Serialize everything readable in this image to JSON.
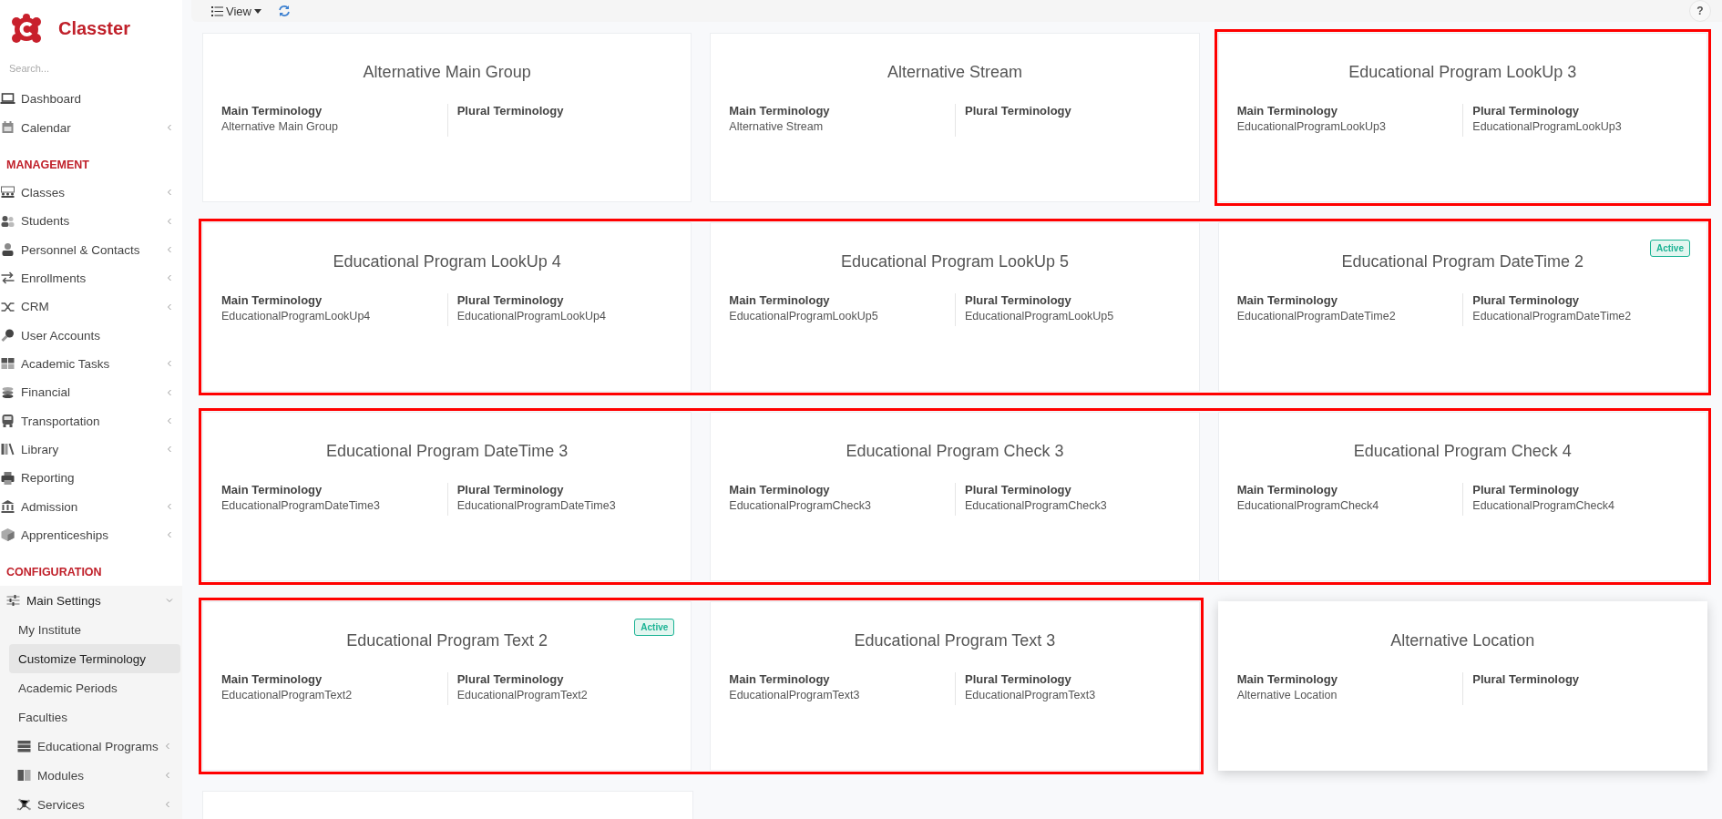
{
  "brand": {
    "name": "Classter"
  },
  "search": {
    "placeholder": "Search..."
  },
  "nav": [
    {
      "kind": "item",
      "label": "Dashboard",
      "expandable": false,
      "selected": false
    },
    {
      "kind": "item",
      "label": "Calendar",
      "expandable": true,
      "expanded": false,
      "selected": false
    },
    {
      "kind": "header",
      "label": "MANAGEMENT"
    },
    {
      "kind": "item",
      "label": "Classes",
      "expandable": true,
      "expanded": false,
      "selected": false
    },
    {
      "kind": "item",
      "label": "Students",
      "expandable": true,
      "expanded": false,
      "selected": false
    },
    {
      "kind": "item",
      "label": "Personnel & Contacts",
      "expandable": true,
      "expanded": false,
      "selected": false
    },
    {
      "kind": "item",
      "label": "Enrollments",
      "expandable": true,
      "expanded": false,
      "selected": false
    },
    {
      "kind": "item",
      "label": "CRM",
      "expandable": true,
      "expanded": false,
      "selected": false
    },
    {
      "kind": "item",
      "label": "User Accounts",
      "expandable": false,
      "selected": false
    },
    {
      "kind": "item",
      "label": "Academic Tasks",
      "expandable": true,
      "expanded": false,
      "selected": false
    },
    {
      "kind": "item",
      "label": "Financial",
      "expandable": true,
      "expanded": false,
      "selected": false
    },
    {
      "kind": "item",
      "label": "Transportation",
      "expandable": true,
      "expanded": false,
      "selected": false
    },
    {
      "kind": "item",
      "label": "Library",
      "expandable": true,
      "expanded": false,
      "selected": false
    },
    {
      "kind": "item",
      "label": "Reporting",
      "expandable": false,
      "selected": false
    },
    {
      "kind": "item",
      "label": "Admission",
      "expandable": true,
      "expanded": false,
      "selected": false
    },
    {
      "kind": "item",
      "label": "Apprenticeships",
      "expandable": true,
      "expanded": false,
      "selected": false
    },
    {
      "kind": "header",
      "label": "CONFIGURATION"
    },
    {
      "kind": "item",
      "label": "Main Settings",
      "expandable": true,
      "expanded": true,
      "selected": false,
      "children": [
        {
          "kind": "link",
          "label": "My Institute",
          "selected": false
        },
        {
          "kind": "link",
          "label": "Customize Terminology",
          "selected": true
        },
        {
          "kind": "link",
          "label": "Academic Periods",
          "selected": false
        },
        {
          "kind": "link",
          "label": "Faculties",
          "selected": false
        },
        {
          "kind": "item",
          "label": "Educational Programs",
          "expandable": true,
          "expanded": false,
          "selected": false
        },
        {
          "kind": "item",
          "label": "Modules",
          "expandable": true,
          "expanded": false,
          "selected": false
        },
        {
          "kind": "item",
          "label": "Services",
          "expandable": true,
          "expanded": false,
          "selected": false
        }
      ]
    }
  ],
  "toolbar": {
    "view_label": "View",
    "help": "?"
  },
  "rows": [
    {
      "cards": [
        {
          "title": "Alternative Main Group",
          "main_label": "Main Terminology",
          "main_value": "Alternative Main Group",
          "plural_label": "Plural Terminology",
          "highlighted": false,
          "hovered": false
        },
        {
          "title": "Alternative Stream",
          "main_label": "Main Terminology",
          "main_value": "Alternative Stream",
          "plural_label": "Plural Terminology",
          "highlighted": false,
          "hovered": false
        },
        {
          "title": "Educational Program LookUp 3",
          "main_label": "Main Terminology",
          "main_value": "EducationalProgramLookUp3",
          "plural_label": "Plural Terminology",
          "plural_value": "EducationalProgramLookUp3",
          "highlighted": true,
          "hovered": false
        }
      ]
    },
    {
      "cards": [
        {
          "title": "Educational Program LookUp 4",
          "main_label": "Main Terminology",
          "main_value": "EducationalProgramLookUp4",
          "plural_label": "Plural Terminology",
          "plural_value": "EducationalProgramLookUp4",
          "highlighted": true,
          "hovered": false
        },
        {
          "title": "Educational Program LookUp 5",
          "main_label": "Main Terminology",
          "main_value": "EducationalProgramLookUp5",
          "plural_label": "Plural Terminology",
          "plural_value": "EducationalProgramLookUp5",
          "highlighted": true,
          "hovered": false
        },
        {
          "title": "Educational Program DateTime 2",
          "badge": "Active",
          "main_label": "Main Terminology",
          "main_value": "EducationalProgramDateTime2",
          "plural_label": "Plural Terminology",
          "plural_value": "EducationalProgramDateTime2",
          "highlighted": true,
          "hovered": false
        }
      ]
    },
    {
      "cards": [
        {
          "title": "Educational Program DateTime 3",
          "main_label": "Main Terminology",
          "main_value": "EducationalProgramDateTime3",
          "plural_label": "Plural Terminology",
          "plural_value": "EducationalProgramDateTime3",
          "highlighted": true,
          "hovered": false
        },
        {
          "title": "Educational Program Check 3",
          "main_label": "Main Terminology",
          "main_value": "EducationalProgramCheck3",
          "plural_label": "Plural Terminology",
          "plural_value": "EducationalProgramCheck3",
          "highlighted": true,
          "hovered": false
        },
        {
          "title": "Educational Program Check 4",
          "main_label": "Main Terminology",
          "main_value": "EducationalProgramCheck4",
          "plural_label": "Plural Terminology",
          "plural_value": "EducationalProgramCheck4",
          "highlighted": true,
          "hovered": false
        }
      ]
    },
    {
      "cards": [
        {
          "title": "Educational Program Text 2",
          "badge": "Active",
          "main_label": "Main Terminology",
          "main_value": "EducationalProgramText2",
          "plural_label": "Plural Terminology",
          "plural_value": "EducationalProgramText2",
          "highlighted": true,
          "hovered": false
        },
        {
          "title": "Educational Program Text 3",
          "main_label": "Main Terminology",
          "main_value": "EducationalProgramText3",
          "plural_label": "Plural Terminology",
          "plural_value": "EducationalProgramText3",
          "highlighted": true,
          "hovered": false
        },
        {
          "title": "Alternative Location",
          "main_label": "Main Terminology",
          "main_value": "Alternative Location",
          "plural_label": "Plural Terminology",
          "highlighted": false,
          "hovered": true
        }
      ]
    }
  ]
}
